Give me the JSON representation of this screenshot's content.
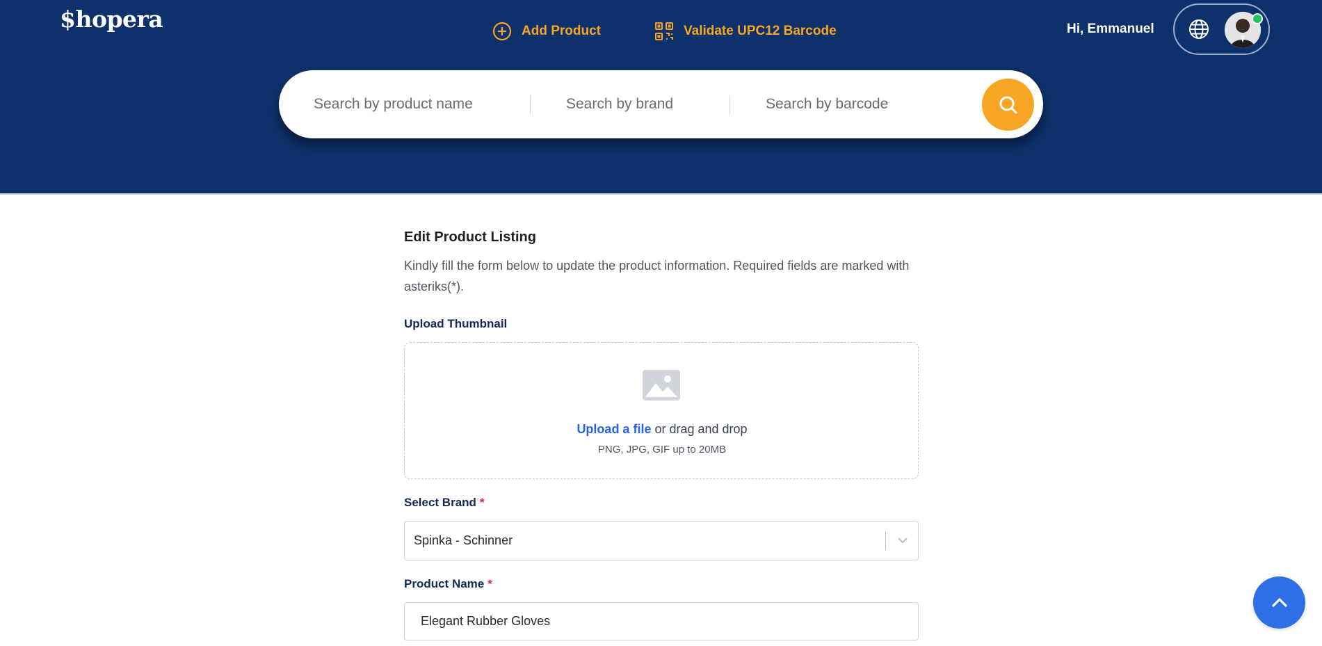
{
  "header": {
    "logo": "$hopera",
    "nav": {
      "add_product": "Add Product",
      "validate_barcode": "Validate UPC12 Barcode"
    },
    "greeting": "Hi, Emmanuel",
    "colors": {
      "background": "#0f316b",
      "accent": "#f6a623"
    }
  },
  "search": {
    "product_placeholder": "Search by product name",
    "brand_placeholder": "Search by brand",
    "barcode_placeholder": "Search by barcode"
  },
  "form": {
    "title": "Edit Product Listing",
    "description": "Kindly fill the form below to update the product information. Required fields are marked with asteriks(*).",
    "thumbnail": {
      "label": "Upload Thumbnail",
      "link": "Upload a file",
      "text": " or drag and drop",
      "hint": "PNG, JPG, GIF up to 20MB"
    },
    "brand": {
      "label": "Select Brand",
      "required": "*",
      "value": "Spinka - Schinner"
    },
    "product_name": {
      "label": "Product Name",
      "required": "*",
      "value": "Elegant Rubber Gloves"
    }
  },
  "icons": {
    "add": "plus-circle-icon",
    "validate": "qr-code-icon",
    "language": "globe-icon",
    "search": "magnifier-icon",
    "image": "image-icon",
    "dropdown": "chevron-down-icon",
    "scroll_top": "chevron-up-icon"
  }
}
